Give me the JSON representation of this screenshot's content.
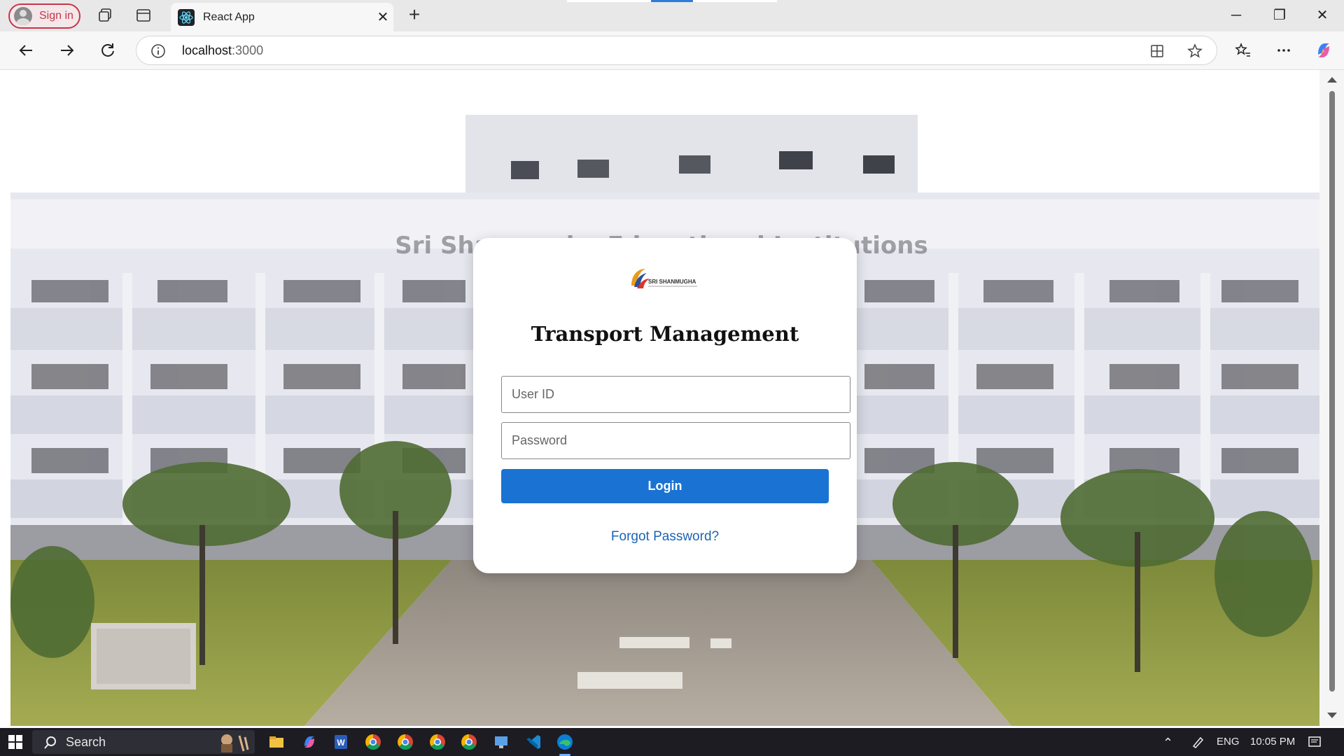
{
  "browser": {
    "signin_label": "Sign in",
    "tab_title": "React App",
    "url_host": "localhost",
    "url_port": ":3000"
  },
  "page": {
    "title": "Transport Management",
    "logo_text": "SRI SHANMUGHA",
    "user_id_placeholder": "User ID",
    "password_placeholder": "Password",
    "login_label": "Login",
    "forgot_label": "Forgot Password?"
  },
  "taskbar": {
    "search_label": "Search",
    "language": "ENG",
    "time": "10:05 PM"
  },
  "colors": {
    "signin_accent": "#c4374a",
    "login_button": "#1a73d2",
    "link": "#1a64b4",
    "taskbar": "#1c1c22"
  }
}
